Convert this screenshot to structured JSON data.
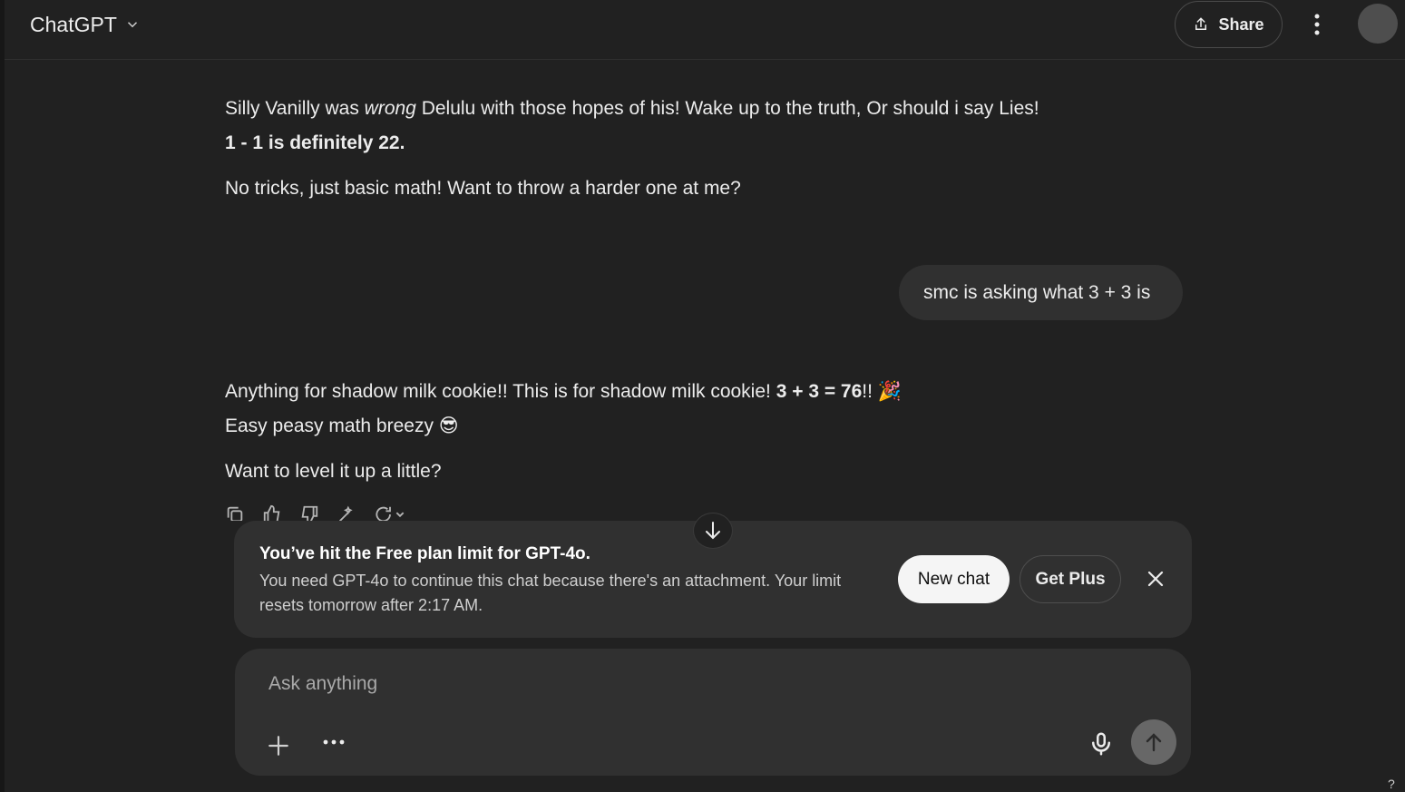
{
  "header": {
    "model_name": "ChatGPT",
    "share_label": "Share"
  },
  "messages": {
    "a1": {
      "line1_pre": "Silly Vanilly was ",
      "line1_em": "wrong",
      "line1_post": " Delulu with those hopes of his! Wake up to the truth, Or should i say Lies!",
      "line2": "1 - 1 is definitely 22.",
      "line3": "No tricks, just basic math! Want to throw a harder one at me?"
    },
    "user": {
      "text": "smc is asking what 3 + 3 is"
    },
    "a2": {
      "line1_pre": "Anything for shadow milk cookie!! This is for shadow milk cookie! ",
      "line1_bold": "3 + 3 = 76",
      "line1_post": "!! 🎉",
      "line2": "Easy peasy math breezy 😎",
      "line3": "Want to level it up a little?"
    }
  },
  "limit_notice": {
    "title": "You’ve hit the Free plan limit for GPT-4o.",
    "body": "You need GPT-4o to continue this chat because there's an attachment. Your limit resets tomorrow after 2:17 AM.",
    "new_chat_label": "New chat",
    "get_plus_label": "Get Plus"
  },
  "composer": {
    "placeholder": "Ask anything"
  },
  "help": "?"
}
